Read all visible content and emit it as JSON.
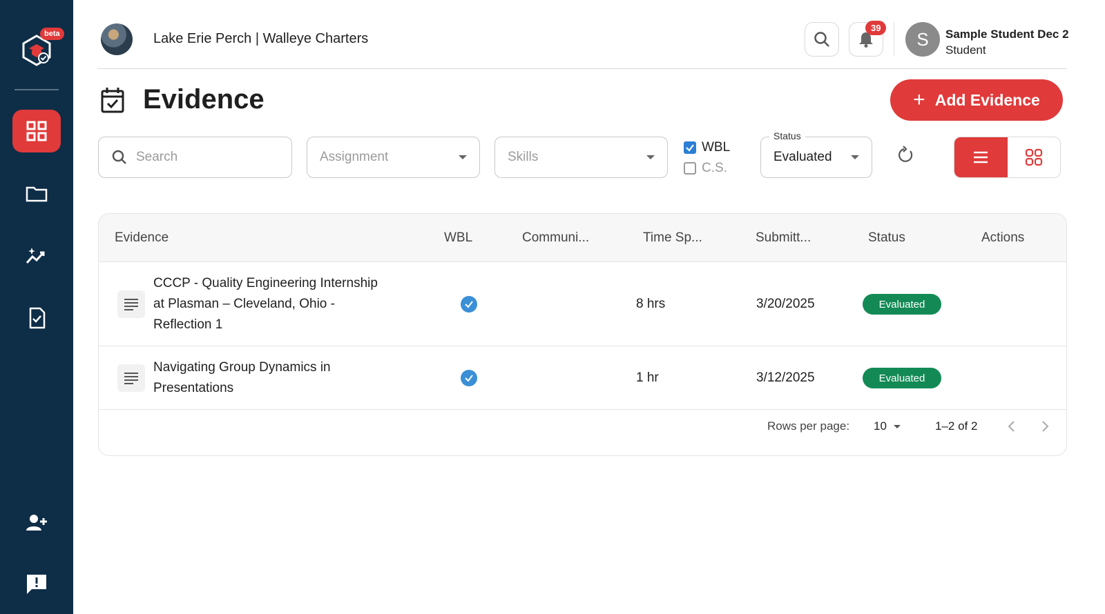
{
  "sidebar": {
    "beta_label": "beta"
  },
  "header": {
    "org_name": "Lake Erie Perch | Walleye Charters",
    "notification_count": "39",
    "user_initial": "S",
    "user_name": "Sample Student Dec 2",
    "user_role": "Student"
  },
  "page": {
    "title": "Evidence",
    "add_button_label": "Add Evidence"
  },
  "filters": {
    "search_placeholder": "Search",
    "assignment_placeholder": "Assignment",
    "skills_placeholder": "Skills",
    "wbl_label": "WBL",
    "wbl_checked": true,
    "cs_label": "C.S.",
    "cs_checked": false,
    "status_label": "Status",
    "status_value": "Evaluated"
  },
  "table": {
    "columns": [
      "Evidence",
      "WBL",
      "Communi...",
      "Time Sp...",
      "Submitt...",
      "Status",
      "Actions"
    ],
    "rows": [
      {
        "title_lines": [
          "CCCP - Quality Engineering Internship",
          "at Plasman – Cleveland, Ohio -",
          "Reflection 1"
        ],
        "wbl": true,
        "time_spent": "8 hrs",
        "submitted": "3/20/2025",
        "status": "Evaluated"
      },
      {
        "title_lines": [
          "Navigating Group Dynamics in",
          "Presentations"
        ],
        "wbl": true,
        "time_spent": "1 hr",
        "submitted": "3/12/2025",
        "status": "Evaluated"
      }
    ],
    "pagination": {
      "rows_per_page_label": "Rows per page:",
      "rows_per_page": "10",
      "range": "1–2 of 2"
    }
  },
  "colors": {
    "accent": "#e03a3a",
    "sidebar": "#0e2d47",
    "status_green": "#138a55",
    "check_blue": "#3a8fd6"
  }
}
